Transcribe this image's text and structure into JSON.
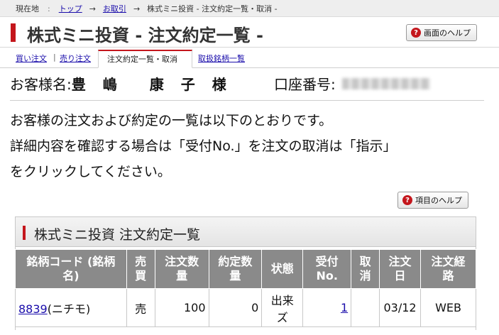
{
  "breadcrumb": {
    "current": "現在地",
    "sep": ":",
    "arrow1": "→",
    "arrow2": "→",
    "top": "トップ",
    "trade": "お取引",
    "page": "株式ミニ投資 - 注文約定一覧・取消 -"
  },
  "header": {
    "title": "株式ミニ投資 - 注文約定一覧 -",
    "help_label": "画面のヘルプ",
    "help_icon": "?"
  },
  "tabs": {
    "buy": "買い注文",
    "sep": "|",
    "sell": "売り注文",
    "active": "注文約定一覧・取消",
    "stocks": "取扱銘柄一覧"
  },
  "customer": {
    "name_label": "お客様名:",
    "name": "豊　嶋　　康　子　様",
    "account_label": "口座番号:"
  },
  "description": {
    "line1": "お客様の注文および約定の一覧は以下のとおりです。",
    "line2": "詳細内容を確認する場合は「受付No.」を注文の取消は「指示」",
    "line3": "をクリックしてください。"
  },
  "item_help": {
    "label": "項目のヘルプ",
    "icon": "?"
  },
  "panel": {
    "title": "株式ミニ投資 注文約定一覧"
  },
  "table": {
    "headers": {
      "code_a": "銘柄コード (銘柄",
      "code_b": "名)",
      "side_a": "売",
      "side_b": "買",
      "qty_a": "注文数",
      "qty_b": "量",
      "filled_a": "約定数",
      "filled_b": "量",
      "status": "状態",
      "receipt_a": "受付",
      "receipt_b": "No.",
      "cancel_a": "取",
      "cancel_b": "消",
      "date_a": "注文",
      "date_b": "日",
      "route_a": "注文経",
      "route_b": "路"
    },
    "rows": [
      {
        "code": "8839",
        "name": "(ニチモ)",
        "side": "売",
        "qty": "100",
        "filled": "0",
        "status_a": "出来",
        "status_b": "ズ",
        "receipt": "1",
        "cancel": "",
        "date": "03/12",
        "route": "WEB"
      }
    ]
  },
  "colors": {
    "accent": "#c4161c",
    "link": "#1a0dab",
    "table_header": "#8a8a8a"
  }
}
